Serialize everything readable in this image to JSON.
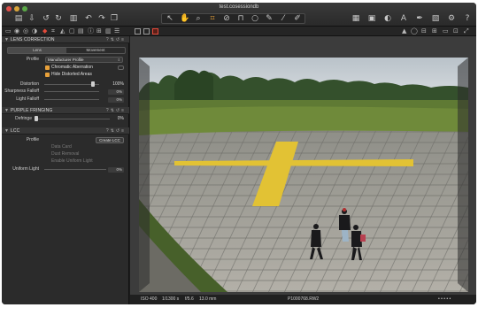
{
  "window": {
    "title": "test.cosessiondb"
  },
  "toolbar": {
    "left_icons": [
      "folder-icon",
      "import-icon",
      "rotate-left-icon",
      "rotate-right-icon",
      "trash-icon",
      "undo-icon",
      "redo-icon",
      "copy-icon"
    ],
    "tools": [
      "cursor-icon",
      "hand-icon",
      "zoom-icon",
      "crop-icon",
      "straighten-icon",
      "keystone-icon",
      "circle-icon",
      "brush-icon",
      "eyedropper-icon",
      "annotate-icon"
    ],
    "right_icons": [
      "grid-icon",
      "layout-icon",
      "exposure-icon",
      "text-icon",
      "brush-adjust-icon",
      "compare-icon",
      "settings-icon",
      "help-icon"
    ]
  },
  "lens_panel": {
    "header": "LENS CORRECTION",
    "tabs": [
      "Lens",
      "Movement"
    ],
    "profile_label": "Profile",
    "profile_value": "Manufacturer Profile",
    "chromatic_aberration_label": "Chromatic Aberration",
    "chromatic_aberration_checked": true,
    "hide_distorted_label": "Hide Distorted Areas",
    "hide_distorted_checked": true,
    "distortion_label": "Distortion",
    "distortion_value": "100%",
    "sharpness_falloff_label": "Sharpness Falloff",
    "sharpness_falloff_value": "0%",
    "light_falloff_label": "Light Falloff",
    "light_falloff_value": "0%"
  },
  "fringe_panel": {
    "header": "PURPLE FRINGING",
    "defringe_label": "Defringe",
    "defringe_value": "0%"
  },
  "lcc_panel": {
    "header": "LCC",
    "profile_label": "Profile",
    "create_button": "Create LCC",
    "items": [
      "Data Card",
      "Dust Removal",
      "Enable Uniform Light"
    ],
    "uniform_light_label": "Uniform Light",
    "uniform_light_value": "0%"
  },
  "status": {
    "iso": "ISO 400",
    "shutter": "1/1300 s",
    "aperture": "f/5.6",
    "focal": "13.0 mm",
    "filename": "P1000768.RW2",
    "rating_dots": "• • • • •"
  },
  "colors": {
    "accent_orange": "#e8a13a",
    "active_red": "#e34a3a",
    "panel_bg": "#2b2b2b"
  }
}
